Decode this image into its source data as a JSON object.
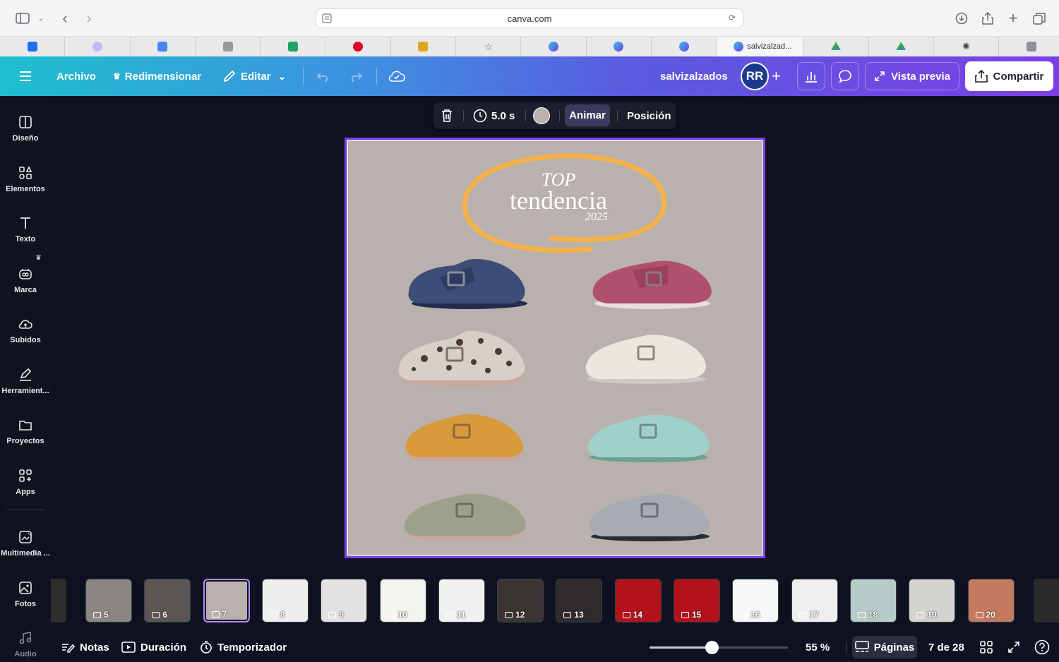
{
  "browser": {
    "url": "canva.com",
    "active_tab_title": "salvizalzad...",
    "tab_favicons": [
      "trello-icon",
      "purple-icon",
      "docs-icon",
      "g-icon",
      "sheets-icon",
      "pinterest-icon",
      "spain-icon",
      "star-icon",
      "canva-icon",
      "canva-icon",
      "canva-icon",
      "canva-icon",
      "drive-icon",
      "drive-icon",
      "openai-icon",
      "c-icon"
    ]
  },
  "topbar": {
    "file": "Archivo",
    "resize": "Redimensionar",
    "edit": "Editar",
    "team": "salvizalzados",
    "avatar": "RR",
    "preview": "Vista previa",
    "share": "Compartir"
  },
  "sidebar": {
    "items": [
      {
        "label": "Diseño"
      },
      {
        "label": "Elementos"
      },
      {
        "label": "Texto"
      },
      {
        "label": "Marca"
      },
      {
        "label": "Subidos"
      },
      {
        "label": "Herramient..."
      },
      {
        "label": "Proyectos"
      },
      {
        "label": "Apps"
      },
      {
        "label": "Multimedia ..."
      },
      {
        "label": "Fotos"
      },
      {
        "label": "Audio"
      }
    ]
  },
  "floating_toolbar": {
    "duration": "5.0 s",
    "animate": "Animar",
    "position": "Posición"
  },
  "design": {
    "title_top": "TOP",
    "title_main": "tendencia",
    "title_year": "2025",
    "colors": {
      "bg": "#b9b1ad",
      "ring": "#f6b24a"
    },
    "shoes": [
      "navy-felt-clog",
      "pink-sherpa-clog",
      "leopard-sherpa-clog",
      "cream-sherpa-clog",
      "mustard-sherpa-clog",
      "aqua-sherpa-clog",
      "sage-sherpa-clog",
      "grey-felt-clog"
    ]
  },
  "pages": {
    "thumbs": [
      {
        "n": "5",
        "bg": "#8a8783"
      },
      {
        "n": "6",
        "bg": "#5a5753"
      },
      {
        "n": "7",
        "bg": "#b9b1ad",
        "selected": true
      },
      {
        "n": "8",
        "bg": "#efeeed"
      },
      {
        "n": "9",
        "bg": "#e4e2e0"
      },
      {
        "n": "10",
        "bg": "#f5f3ef"
      },
      {
        "n": "11",
        "bg": "#f2f0ee"
      },
      {
        "n": "12",
        "bg": "#3a3533"
      },
      {
        "n": "13",
        "bg": "#2e2b2a"
      },
      {
        "n": "14",
        "bg": "#b3121a"
      },
      {
        "n": "15",
        "bg": "#b3121a"
      },
      {
        "n": "16",
        "bg": "#f7f7f7"
      },
      {
        "n": "17",
        "bg": "#f0efee"
      },
      {
        "n": "18",
        "bg": "#b9cbc8"
      },
      {
        "n": "19",
        "bg": "#d5d3d0"
      },
      {
        "n": "20",
        "bg": "#c47a5e"
      }
    ]
  },
  "bottombar": {
    "notes": "Notas",
    "duration": "Duración",
    "timer": "Temporizador",
    "zoom": "55 %",
    "zoom_value": 0.45,
    "pages_label": "Páginas",
    "page_counter": "7 de 28"
  }
}
